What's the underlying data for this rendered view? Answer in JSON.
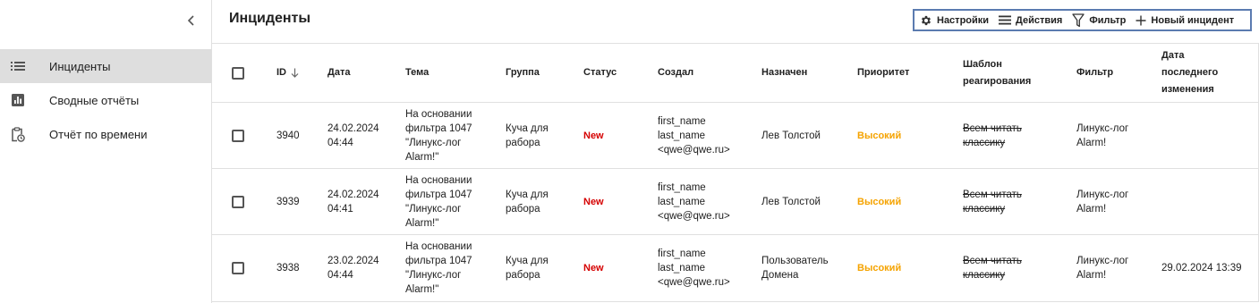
{
  "sidebar": {
    "items": [
      {
        "label": "Инциденты",
        "icon": "list-icon",
        "active": true
      },
      {
        "label": "Сводные отчёты",
        "icon": "bar-chart-icon",
        "active": false
      },
      {
        "label": "Отчёт по времени",
        "icon": "clipboard-clock-icon",
        "active": false
      }
    ]
  },
  "header": {
    "title": "Инциденты"
  },
  "toolbar": {
    "settings_label": "Настройки",
    "actions_label": "Действия",
    "filter_label": "Фильтр",
    "new_label": "Новый инцидент"
  },
  "table": {
    "columns": {
      "id": "ID",
      "date": "Дата",
      "subject": "Тема",
      "group": "Группа",
      "status": "Статус",
      "created_by": "Создал",
      "assigned": "Назначен",
      "priority": "Приоритет",
      "template_1": "Шаблон",
      "template_2": "реагирования",
      "filter": "Фильтр",
      "modified_1": "Дата",
      "modified_2": "последнего",
      "modified_3": "изменения"
    },
    "rows": [
      {
        "id": "3940",
        "date_1": "24.02.2024",
        "date_2": "04:44",
        "subject_1": "На основании",
        "subject_2": "фильтра 1047",
        "subject_3": "\"Линукс-лог",
        "subject_4": "Alarm!\"",
        "group_1": "Куча для",
        "group_2": "рабора",
        "status": "New",
        "creator_1": "first_name",
        "creator_2": "last_name",
        "creator_3": "<qwe@qwe.ru>",
        "assigned_1": "Лев Толстой",
        "assigned_2": "",
        "priority": "Высокий",
        "template_1": "Всем читать",
        "template_2": "классику",
        "filter_1": "Линукс-лог",
        "filter_2": "Alarm!",
        "modified": ""
      },
      {
        "id": "3939",
        "date_1": "24.02.2024",
        "date_2": "04:41",
        "subject_1": "На основании",
        "subject_2": "фильтра 1047",
        "subject_3": "\"Линукс-лог",
        "subject_4": "Alarm!\"",
        "group_1": "Куча для",
        "group_2": "рабора",
        "status": "New",
        "creator_1": "first_name",
        "creator_2": "last_name",
        "creator_3": "<qwe@qwe.ru>",
        "assigned_1": "Лев Толстой",
        "assigned_2": "",
        "priority": "Высокий",
        "template_1": "Всем читать",
        "template_2": "классику",
        "filter_1": "Линукс-лог",
        "filter_2": "Alarm!",
        "modified": ""
      },
      {
        "id": "3938",
        "date_1": "23.02.2024",
        "date_2": "04:44",
        "subject_1": "На основании",
        "subject_2": "фильтра 1047",
        "subject_3": "\"Линукс-лог",
        "subject_4": "Alarm!\"",
        "group_1": "Куча для",
        "group_2": "рабора",
        "status": "New",
        "creator_1": "first_name",
        "creator_2": "last_name",
        "creator_3": "<qwe@qwe.ru>",
        "assigned_1": "Пользователь",
        "assigned_2": "Домена",
        "priority": "Высокий",
        "template_1": "Всем читать",
        "template_2": "классику",
        "filter_1": "Линукс-лог",
        "filter_2": "Alarm!",
        "modified": "29.02.2024 13:39"
      }
    ]
  },
  "colors": {
    "status_new": "#d50000",
    "priority_high": "#f5a300",
    "toolbar_border": "#5b7bb0",
    "active_nav_bg": "#dedede"
  }
}
